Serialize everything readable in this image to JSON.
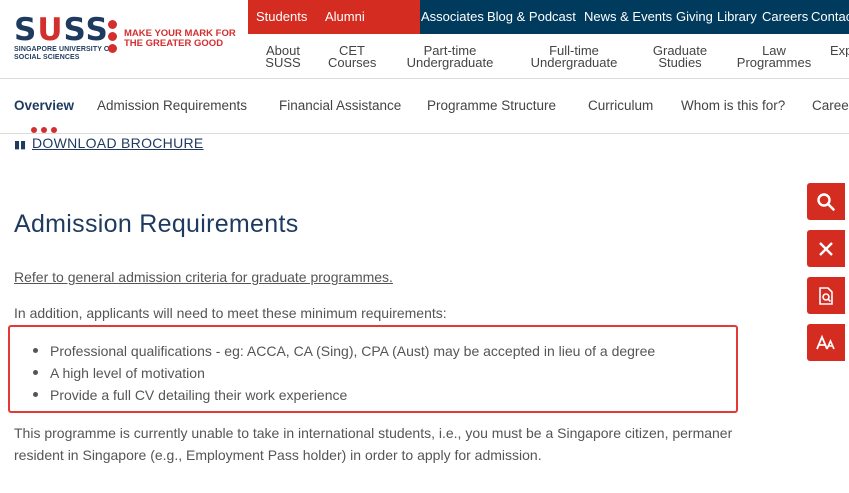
{
  "logo": {
    "wordmark_s1": "S",
    "wordmark_u": "U",
    "wordmark_ss": "SS",
    "subtitle": "Singapore University of Social Sciences",
    "tagline": "Make your mark for the greater good"
  },
  "topbar": {
    "items": [
      "Students",
      "Alumni",
      "Associates",
      "Blog & Podcast",
      "News & Events",
      "Giving",
      "Library",
      "Careers",
      "Contac"
    ]
  },
  "mainnav": {
    "items": [
      "About\nSUSS",
      "CET\nCourses",
      "Part-time\nUndergraduate",
      "Full-time\nUndergraduate",
      "Graduate\nStudies",
      "Law\nProgrammes",
      "Exp"
    ]
  },
  "subnav": {
    "items": [
      "Overview",
      "Admission Requirements",
      "Financial Assistance",
      "Programme Structure",
      "Curriculum",
      "Whom is this for?",
      "Caree"
    ]
  },
  "brochure": {
    "label": "DOWNLOAD BROCHURE"
  },
  "main": {
    "title": "Admission Requirements",
    "general_link": "Refer to general admission criteria for graduate programmes.",
    "intro": "In addition, applicants will need to meet these minimum requirements:",
    "requirements": [
      "Professional qualifications - eg: ACCA, CA (Sing), CPA (Aust) may be accepted in lieu of a degree",
      "A high level of motivation",
      "Provide a full CV detailing their work experience"
    ],
    "note_line1": "This programme is currently unable to take in international students, i.e., you must be a Singapore citizen, permaner",
    "note_line2": "resident in Singapore (e.g., Employment Pass holder) in order to apply for admission."
  },
  "tools": [
    "search-icon",
    "close-icon",
    "document-search-icon",
    "font-size-icon"
  ],
  "colors": {
    "brand_red": "#d42c20",
    "brand_navy": "#003a5d",
    "highlight_box": "#e53935"
  }
}
